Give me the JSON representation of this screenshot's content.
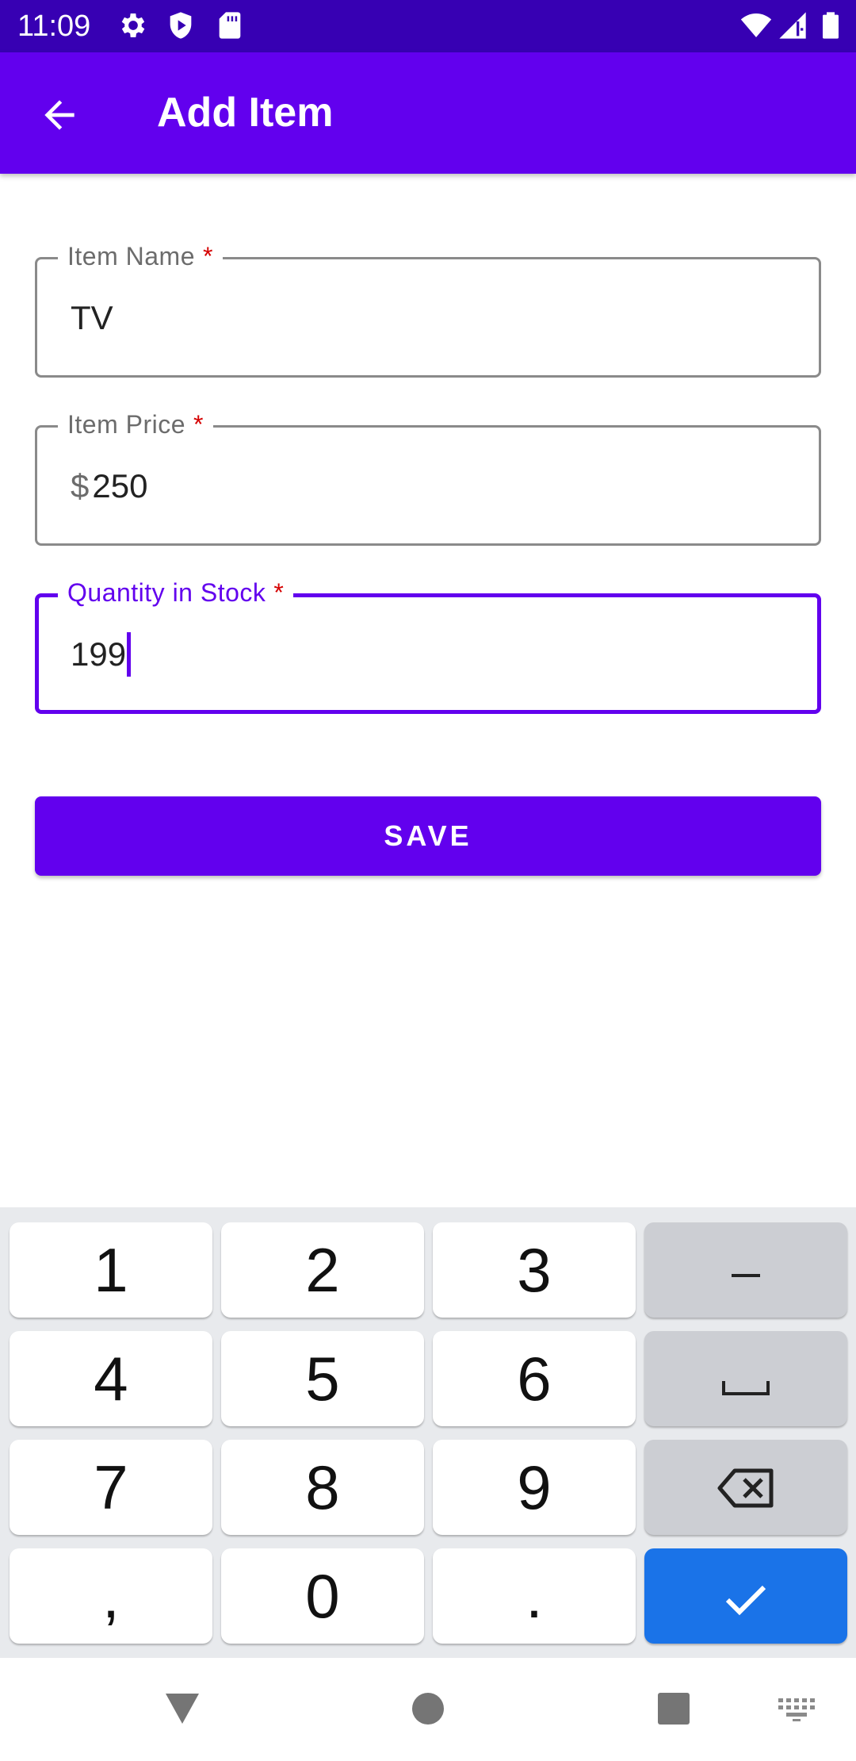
{
  "status_bar": {
    "time": "11:09",
    "icons": [
      "gear-icon",
      "shield-icon",
      "sd-card-icon",
      "wifi-icon",
      "signal-icon",
      "battery-icon"
    ],
    "background": "#3700b3"
  },
  "app_bar": {
    "title": "Add Item",
    "back_icon": "arrow-back-icon",
    "background": "#6200ee"
  },
  "form": {
    "fields": [
      {
        "label": "Item Name",
        "required_mark": "*",
        "prefix": "",
        "value": "TV"
      },
      {
        "label": "Item Price",
        "required_mark": "*",
        "prefix": "$",
        "value": "250"
      },
      {
        "label": "Quantity in Stock",
        "required_mark": "*",
        "prefix": "",
        "value": "199",
        "focused": true
      }
    ],
    "save_label": "SAVE"
  },
  "keyboard": {
    "rows": [
      [
        "1",
        "2",
        "3",
        "minus-icon"
      ],
      [
        "4",
        "5",
        "6",
        "space-icon"
      ],
      [
        "7",
        "8",
        "9",
        "backspace-icon"
      ],
      [
        ",",
        "0",
        ".",
        "check-icon"
      ]
    ],
    "labels": {
      "k1": "1",
      "k2": "2",
      "k3": "3",
      "k4": "4",
      "k5": "5",
      "k6": "6",
      "k7": "7",
      "k8": "8",
      "k9": "9",
      "comma": ",",
      "k0": "0",
      "period": "."
    },
    "done_color": "#1a73e8"
  },
  "nav_bar": {
    "icons": [
      "back-triangle-icon",
      "home-circle-icon",
      "recents-square-icon",
      "keyboard-switch-icon"
    ]
  }
}
